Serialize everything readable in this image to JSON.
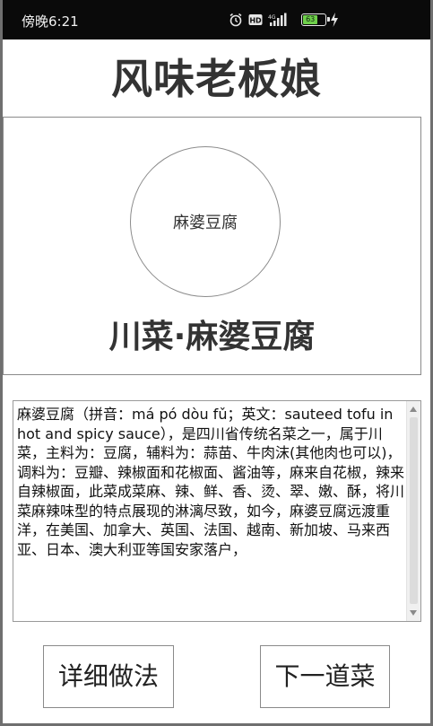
{
  "status_bar": {
    "time": "傍晚6:21",
    "battery_level": "63",
    "icons": [
      "alarm-icon",
      "hd-icon",
      "signal-icon",
      "battery-icon",
      "charging-icon"
    ]
  },
  "app": {
    "title": "风味老板娘"
  },
  "dish": {
    "image_label": "麻婆豆腐",
    "name": "川菜·麻婆豆腐",
    "description": "麻婆豆腐（拼音：má pó dòu fǔ；英文：sauteed tofu in hot and spicy sauce），是四川省传统名菜之一，属于川菜，主料为：豆腐，辅料为：蒜苗、牛肉沫(其他肉也可以)，调料为：豆瓣、辣椒面和花椒面、酱油等，麻来自花椒，辣来自辣椒面，此菜成菜麻、辣、鲜、香、烫、翠、嫩、酥，将川菜麻辣味型的特点展现的淋漓尽致，如今，麻婆豆腐远渡重洋，在美国、加拿大、英国、法国、越南、新加坡、马来西亚、日本、澳大利亚等国安家落户，"
  },
  "buttons": {
    "detail": "详细做法",
    "next": "下一道菜"
  },
  "colors": {
    "status_bar_bg": "#0a0a0a",
    "battery_green": "#6ecf4a",
    "title_text": "#333333",
    "border": "#8a8a8a"
  }
}
